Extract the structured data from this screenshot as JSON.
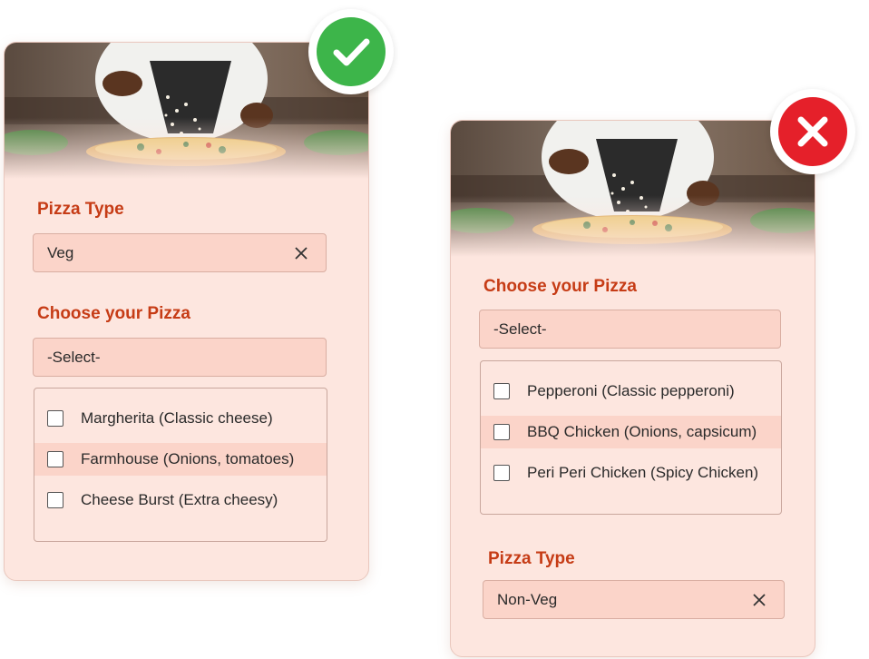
{
  "left_card": {
    "pizza_type_label": "Pizza Type",
    "pizza_type_value": "Veg",
    "choose_label": "Choose your Pizza",
    "select_placeholder": "-Select-",
    "options": [
      {
        "label": "Margherita (Classic cheese)"
      },
      {
        "label": "Farmhouse (Onions, tomatoes)"
      },
      {
        "label": "Cheese Burst (Extra cheesy)"
      }
    ],
    "status": "correct",
    "status_icon": "check-icon",
    "status_color": "#3db54a"
  },
  "right_card": {
    "choose_label": "Choose your Pizza",
    "select_placeholder": "-Select-",
    "options": [
      {
        "label": "Pepperoni (Classic pepperoni)"
      },
      {
        "label": "BBQ Chicken (Onions, capsicum)"
      },
      {
        "label": "Peri Peri Chicken (Spicy Chicken)"
      }
    ],
    "pizza_type_label": "Pizza Type",
    "pizza_type_value": "Non-Veg",
    "status": "incorrect",
    "status_icon": "x-icon",
    "status_color": "#e5202a"
  },
  "colors": {
    "accent_label": "#c63c16",
    "card_bg": "#fde6df",
    "field_bg": "#fbd4c9"
  }
}
